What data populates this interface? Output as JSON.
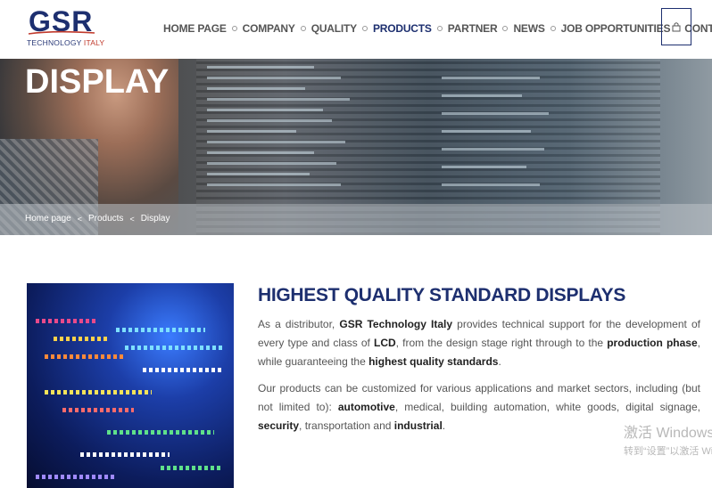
{
  "logo": {
    "main": "GSR",
    "sub_a": "TECHNOLOGY ",
    "sub_b": "ITALY"
  },
  "nav": {
    "items": [
      {
        "label": "HOME PAGE"
      },
      {
        "label": "COMPANY"
      },
      {
        "label": "QUALITY"
      },
      {
        "label": "PRODUCTS"
      },
      {
        "label": "PARTNER"
      },
      {
        "label": "NEWS"
      },
      {
        "label": "JOB OPPORTUNITIES"
      },
      {
        "label": "CONTACTS"
      }
    ],
    "active_index": 3
  },
  "cart": {
    "icon": "lock-icon"
  },
  "hero": {
    "title": "DISPLAY",
    "breadcrumb": [
      "Home page",
      "Products",
      "Display"
    ],
    "separator": "<"
  },
  "content": {
    "heading": "HIGHEST QUALITY STANDARD DISPLAYS",
    "p1": {
      "t1": "As a distributor, ",
      "b1": "GSR Technology Italy",
      "t2": " provides technical support for the development of every type and class of ",
      "b2": "LCD",
      "t3": ", from the design stage right through to the ",
      "b3": "production phase",
      "t4": ", while guaranteeing the ",
      "b4": "highest quality standards",
      "t5": "."
    },
    "p2": {
      "t1": "Our products can be customized for various applications and market sectors, including (but not limited to): ",
      "b1": "automotive",
      "t2": ", medical, building automation, white goods, digital signage, ",
      "b2": "security",
      "t3": ", transportation and ",
      "b3": "industrial",
      "t4": "."
    }
  },
  "watermark": {
    "line1": "激活 Windows",
    "line2": "转到“设置”以激活 Windows。"
  },
  "colors": {
    "brand": "#1d2f6f",
    "accent": "#c0392b",
    "text": "#555555"
  }
}
